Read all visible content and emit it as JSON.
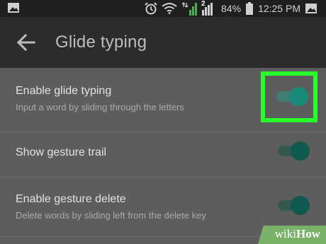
{
  "status_bar": {
    "icons": [
      "image-icon",
      "alarm-icon",
      "wifi-icon",
      "signal-icon",
      "signal-2-icon",
      "battery-icon"
    ],
    "battery_percent": "84%",
    "time": "12:25 PM",
    "sim_badge": "2"
  },
  "toolbar": {
    "back_icon": "arrow-left-icon",
    "title": "Glide typing"
  },
  "settings": [
    {
      "title": "Enable glide typing",
      "summary": "Input a word by sliding through the letters",
      "enabled": true,
      "highlighted": true
    },
    {
      "title": "Show gesture trail",
      "summary": "",
      "enabled": true,
      "highlighted": false
    },
    {
      "title": "Enable gesture delete",
      "summary": "Delete words by sliding left from the delete key",
      "enabled": true,
      "highlighted": false
    }
  ],
  "colors": {
    "accent": "#1a8a78",
    "accent_dark": "#0f5a4e",
    "highlight": "#2bff2b",
    "statusbar_bg": "#1f1f1f",
    "toolbar_bg": "#2c2c2c",
    "content_bg": "#5d5d5d"
  },
  "watermark": {
    "wiki": "wiki",
    "how": "How"
  }
}
